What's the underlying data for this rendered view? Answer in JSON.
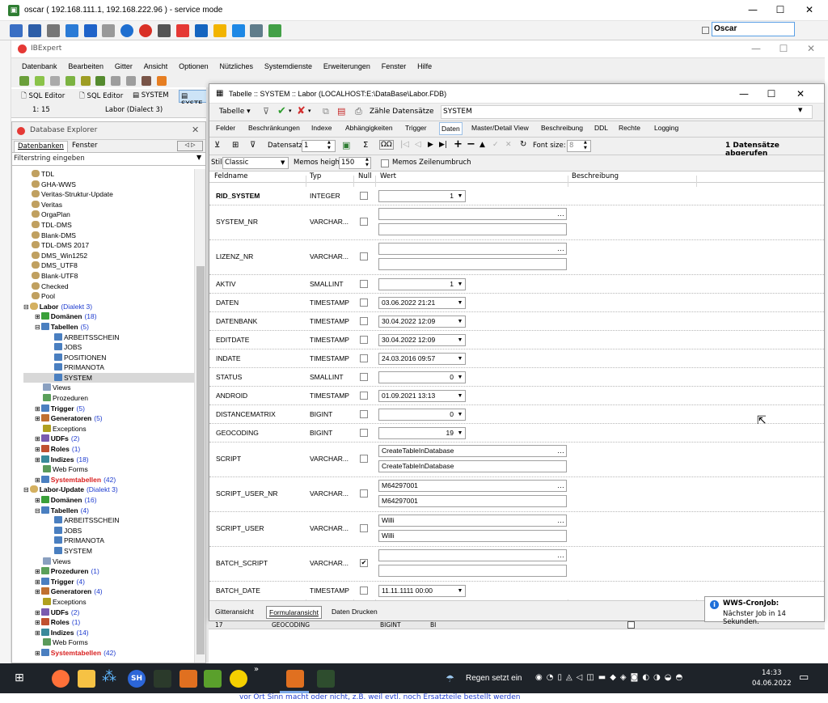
{
  "outer": {
    "title": "oscar ( 192.168.111.1, 192.168.222.96 ) - service mode",
    "user_field": "Oscar",
    "controls": [
      "—",
      "☐",
      "✕"
    ]
  },
  "ib": {
    "title": "IBExpert",
    "menu": [
      "Datenbank",
      "Bearbeiten",
      "Gitter",
      "Ansicht",
      "Optionen",
      "Nützliches",
      "Systemdienste",
      "Erweiterungen",
      "Fenster",
      "Hilfe"
    ],
    "doc_tabs": [
      "SQL Editor",
      "SQL Editor",
      "SYSTEM",
      "SYSTE"
    ],
    "status_pos": "1:  15",
    "status_db": "Labor (Dialect 3)"
  },
  "explorer": {
    "title": "Database Explorer",
    "tabs": [
      "Datenbanken",
      "Fenster"
    ],
    "filter_placeholder": "Filterstring eingeben",
    "tree": [
      {
        "indent": 0,
        "label": "TDL",
        "count": "",
        "style": "",
        "icon": "db"
      },
      {
        "indent": 0,
        "label": "GHA-WWS",
        "count": "",
        "style": "",
        "icon": "db"
      },
      {
        "indent": 0,
        "label": "Veritas-Struktur-Update",
        "count": "",
        "style": "",
        "icon": "db"
      },
      {
        "indent": 0,
        "label": "Veritas",
        "count": "",
        "style": "",
        "icon": "db"
      },
      {
        "indent": 0,
        "label": "OrgaPlan",
        "count": "",
        "style": "",
        "icon": "db"
      },
      {
        "indent": 0,
        "label": "TDL-DMS",
        "count": "",
        "style": "",
        "icon": "db"
      },
      {
        "indent": 0,
        "label": "Blank-DMS",
        "count": "",
        "style": "",
        "icon": "db"
      },
      {
        "indent": 0,
        "label": "TDL-DMS 2017",
        "count": "",
        "style": "",
        "icon": "db"
      },
      {
        "indent": 0,
        "label": "DMS_Win1252",
        "count": "",
        "style": "",
        "icon": "db"
      },
      {
        "indent": 0,
        "label": "DMS_UTF8",
        "count": "",
        "style": "",
        "icon": "db"
      },
      {
        "indent": 0,
        "label": "Blank-UTF8",
        "count": "",
        "style": "",
        "icon": "db"
      },
      {
        "indent": 0,
        "label": "Checked",
        "count": "",
        "style": "",
        "icon": "db"
      },
      {
        "indent": 0,
        "label": "Pool",
        "count": "",
        "style": "",
        "icon": "db"
      },
      {
        "indent": 0,
        "label": "Labor",
        "count": "(Dialekt 3)",
        "style": "bold",
        "icon": "db-open",
        "exp": "⊟"
      },
      {
        "indent": 1,
        "label": "Domänen",
        "count": "(18)",
        "style": "bold",
        "icon": "dom",
        "exp": "⊞"
      },
      {
        "indent": 1,
        "label": "Tabellen",
        "count": "(5)",
        "style": "bold",
        "icon": "tbl",
        "exp": "⊟"
      },
      {
        "indent": 2,
        "label": "ARBEITSSCHEIN",
        "count": "",
        "style": "",
        "icon": "tbl"
      },
      {
        "indent": 2,
        "label": "JOBS",
        "count": "",
        "style": "",
        "icon": "tbl"
      },
      {
        "indent": 2,
        "label": "POSITIONEN",
        "count": "",
        "style": "",
        "icon": "tbl"
      },
      {
        "indent": 2,
        "label": "PRIMANOTA",
        "count": "",
        "style": "",
        "icon": "tbl"
      },
      {
        "indent": 2,
        "label": "SYSTEM",
        "count": "",
        "style": "selected",
        "icon": "tbl"
      },
      {
        "indent": 1,
        "label": "Views",
        "count": "",
        "style": "",
        "icon": "view"
      },
      {
        "indent": 1,
        "label": "Prozeduren",
        "count": "",
        "style": "",
        "icon": "proc"
      },
      {
        "indent": 1,
        "label": "Trigger",
        "count": "(5)",
        "style": "bold",
        "icon": "trig",
        "exp": "⊞"
      },
      {
        "indent": 1,
        "label": "Generatoren",
        "count": "(5)",
        "style": "bold",
        "icon": "gen",
        "exp": "⊞"
      },
      {
        "indent": 1,
        "label": "Exceptions",
        "count": "",
        "style": "",
        "icon": "exc"
      },
      {
        "indent": 1,
        "label": "UDFs",
        "count": "(2)",
        "style": "bold",
        "icon": "udf",
        "exp": "⊞"
      },
      {
        "indent": 1,
        "label": "Roles",
        "count": "(1)",
        "style": "bold",
        "icon": "role",
        "exp": "⊞"
      },
      {
        "indent": 1,
        "label": "Indizes",
        "count": "(18)",
        "style": "bold",
        "icon": "idx",
        "exp": "⊞"
      },
      {
        "indent": 1,
        "label": "Web Forms",
        "count": "",
        "style": "",
        "icon": "web"
      },
      {
        "indent": 1,
        "label": "Systemtabellen",
        "count": "(42)",
        "style": "red",
        "icon": "tbl",
        "exp": "⊞"
      },
      {
        "indent": 0,
        "label": "Labor-Update",
        "count": "(Dialekt 3)",
        "style": "bold",
        "icon": "db-open",
        "exp": "⊟"
      },
      {
        "indent": 1,
        "label": "Domänen",
        "count": "(16)",
        "style": "bold",
        "icon": "dom",
        "exp": "⊞"
      },
      {
        "indent": 1,
        "label": "Tabellen",
        "count": "(4)",
        "style": "bold",
        "icon": "tbl",
        "exp": "⊟"
      },
      {
        "indent": 2,
        "label": "ARBEITSSCHEIN",
        "count": "",
        "style": "",
        "icon": "tbl"
      },
      {
        "indent": 2,
        "label": "JOBS",
        "count": "",
        "style": "",
        "icon": "tbl"
      },
      {
        "indent": 2,
        "label": "PRIMANOTA",
        "count": "",
        "style": "",
        "icon": "tbl"
      },
      {
        "indent": 2,
        "label": "SYSTEM",
        "count": "",
        "style": "",
        "icon": "tbl"
      },
      {
        "indent": 1,
        "label": "Views",
        "count": "",
        "style": "",
        "icon": "view"
      },
      {
        "indent": 1,
        "label": "Prozeduren",
        "count": "(1)",
        "style": "bold",
        "icon": "proc",
        "exp": "⊞"
      },
      {
        "indent": 1,
        "label": "Trigger",
        "count": "(4)",
        "style": "bold",
        "icon": "trig",
        "exp": "⊞"
      },
      {
        "indent": 1,
        "label": "Generatoren",
        "count": "(4)",
        "style": "bold",
        "icon": "gen",
        "exp": "⊞"
      },
      {
        "indent": 1,
        "label": "Exceptions",
        "count": "",
        "style": "",
        "icon": "exc"
      },
      {
        "indent": 1,
        "label": "UDFs",
        "count": "(2)",
        "style": "bold",
        "icon": "udf",
        "exp": "⊞"
      },
      {
        "indent": 1,
        "label": "Roles",
        "count": "(1)",
        "style": "bold",
        "icon": "role",
        "exp": "⊞"
      },
      {
        "indent": 1,
        "label": "Indizes",
        "count": "(14)",
        "style": "bold",
        "icon": "idx",
        "exp": "⊞"
      },
      {
        "indent": 1,
        "label": "Web Forms",
        "count": "",
        "style": "",
        "icon": "web"
      },
      {
        "indent": 1,
        "label": "Systemtabellen",
        "count": "(42)",
        "style": "red",
        "icon": "tbl",
        "exp": "⊞"
      }
    ]
  },
  "table_window": {
    "title": "Tabelle :: SYSTEM :: Labor (LOCALHOST:E:\\DataBase\\Labor.FDB)",
    "toolbar_table": "Tabelle",
    "toolbar_count": "Zähle Datensätze",
    "toolbar_name": "SYSTEM",
    "tabs": [
      "Felder",
      "Beschränkungen",
      "Indexe",
      "Abhängigkeiten",
      "Trigger",
      "Daten",
      "Master/Detail View",
      "Beschreibung",
      "DDL",
      "Rechte",
      "Logging"
    ],
    "active_tab": "Daten",
    "nav_record_label": "Datensatz:",
    "nav_record_value": "1",
    "nav_fontsize_label": "Font size:",
    "nav_fontsize_value": "8",
    "record_count": "1 Datensätze abgerufen",
    "style_label": "Stil:",
    "style_value": "Classic",
    "memos_height_label": "Memos height:",
    "memos_height_value": "150",
    "wrap_label": "Memos Zeilenumbruch",
    "col_headers": [
      "Feldname",
      "Typ",
      "Null",
      "Wert",
      "Beschreibung"
    ],
    "rows": [
      {
        "name": "RID_SYSTEM",
        "type": "INTEGER",
        "null": false,
        "kind": "num",
        "value": "1",
        "bold": true
      },
      {
        "name": "SYSTEM_NR",
        "type": "VARCHAR...",
        "null": false,
        "kind": "memo",
        "value": "",
        "value2": ""
      },
      {
        "name": "LIZENZ_NR",
        "type": "VARCHAR...",
        "null": false,
        "kind": "memo",
        "value": "",
        "value2": ""
      },
      {
        "name": "AKTIV",
        "type": "SMALLINT",
        "null": false,
        "kind": "num",
        "value": "1"
      },
      {
        "name": "DATEN",
        "type": "TIMESTAMP",
        "null": false,
        "kind": "date",
        "value": "03.06.2022 21:21"
      },
      {
        "name": "DATENBANK",
        "type": "TIMESTAMP",
        "null": false,
        "kind": "date",
        "value": "30.04.2022 12:09"
      },
      {
        "name": "EDITDATE",
        "type": "TIMESTAMP",
        "null": false,
        "kind": "date",
        "value": "30.04.2022 12:09"
      },
      {
        "name": "INDATE",
        "type": "TIMESTAMP",
        "null": false,
        "kind": "date",
        "value": "24.03.2016 09:57"
      },
      {
        "name": "STATUS",
        "type": "SMALLINT",
        "null": false,
        "kind": "num",
        "value": "0"
      },
      {
        "name": "ANDROID",
        "type": "TIMESTAMP",
        "null": false,
        "kind": "date",
        "value": "01.09.2021 13:13"
      },
      {
        "name": "DISTANCEMATRIX",
        "type": "BIGINT",
        "null": false,
        "kind": "num",
        "value": "0"
      },
      {
        "name": "GEOCODING",
        "type": "BIGINT",
        "null": false,
        "kind": "num",
        "value": "19"
      },
      {
        "name": "SCRIPT",
        "type": "VARCHAR...",
        "null": false,
        "kind": "memo",
        "value": "CreateTableInDatabase",
        "value2": "CreateTableInDatabase"
      },
      {
        "name": "SCRIPT_USER_NR",
        "type": "VARCHAR...",
        "null": false,
        "kind": "memo",
        "value": "M64297001",
        "value2": "M64297001"
      },
      {
        "name": "SCRIPT_USER",
        "type": "VARCHAR...",
        "null": false,
        "kind": "memo",
        "value": "Willi",
        "value2": "Willi"
      },
      {
        "name": "BATCH_SCRIPT",
        "type": "VARCHAR...",
        "null": true,
        "kind": "memo",
        "value": "",
        "value2": ""
      },
      {
        "name": "BATCH_DATE",
        "type": "TIMESTAMP",
        "null": false,
        "kind": "date",
        "value": "11.11.1111 00:00"
      }
    ],
    "bottom_tabs": [
      "Gitteransicht",
      "Formularansicht",
      "Daten Drucken"
    ],
    "active_bottom_tab": "Formularansicht"
  },
  "behind_row": {
    "num": "17",
    "name": "GEOCODING",
    "type": "BIGINT",
    "domain": "BI"
  },
  "notification": {
    "title": "WWS-CronJob:",
    "text": "Nächster Job in 14 Sekunden."
  },
  "taskbar": {
    "weather": "Regen setzt ein",
    "time": "14:33",
    "date": "04.06.2022",
    "sh_label": "SH"
  },
  "below_text": "vor Ort Sinn macht oder nicht, z.B. weil evtl. noch Ersatzteile bestellt werden"
}
